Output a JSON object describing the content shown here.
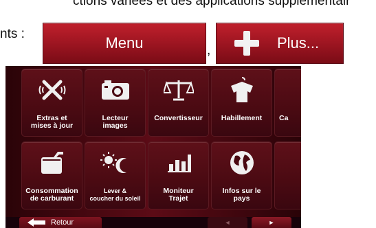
{
  "doc": {
    "line1": "ctions variées et des applications supplémentair",
    "prefix": "nts :",
    "comma": ","
  },
  "buttons": {
    "menu": "Menu",
    "plus": "Plus..."
  },
  "tiles": [
    {
      "label": "Extras et\nmises à jour",
      "icon": "satellite-icon"
    },
    {
      "label": "Lecteur\nimages",
      "icon": "camera-icon"
    },
    {
      "label": "Convertisseur",
      "icon": "scale-icon"
    },
    {
      "label": "Habillement",
      "icon": "shirt-icon"
    },
    {
      "label": "Ca",
      "icon": ""
    },
    {
      "label": "Consommation\nde carburant",
      "icon": "fuel-can-icon"
    },
    {
      "label": "Lever &\ncoucher du soleil",
      "icon": "sun-moon-icon"
    },
    {
      "label": "Moniteur\nTrajet",
      "icon": "bar-chart-icon"
    },
    {
      "label": "Infos sur le\npays",
      "icon": "globe-icon"
    }
  ],
  "bottom": {
    "back": "Retour",
    "prev": "◄",
    "next": "►"
  }
}
